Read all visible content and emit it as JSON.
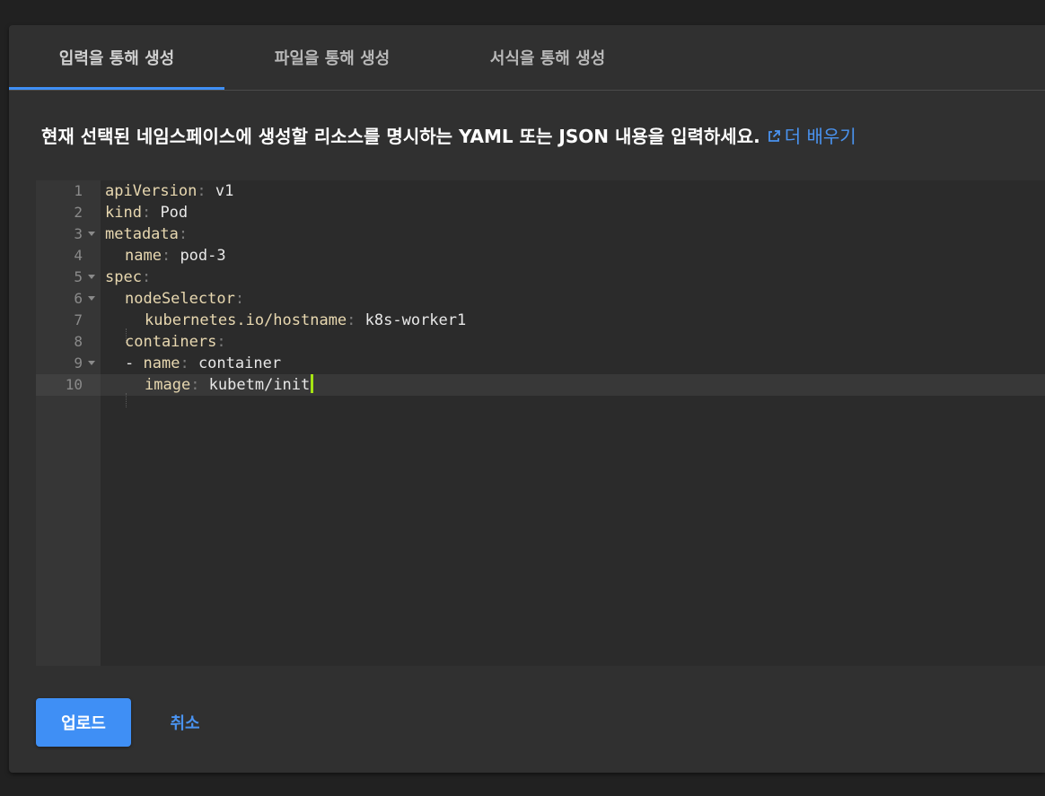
{
  "tabs": [
    {
      "label": "입력을 통해 생성",
      "active": true
    },
    {
      "label": "파일을 통해 생성",
      "active": false
    },
    {
      "label": "서식을 통해 생성",
      "active": false
    }
  ],
  "description": {
    "text": "현재 선택된 네임스페이스에 생성할 리소스를 명시하는 YAML 또는 JSON 내용을 입력하세요.",
    "link_label": "더 배우기",
    "link_icon": "external-link-icon"
  },
  "editor": {
    "language": "YAML",
    "active_line": 10,
    "lines": [
      {
        "num": "1",
        "key": "apiVersion",
        "value": "v1"
      },
      {
        "num": "2",
        "key": "kind",
        "value": "Pod"
      },
      {
        "num": "3",
        "key": "metadata",
        "value": ""
      },
      {
        "num": "4",
        "key": "name",
        "value": "pod-3"
      },
      {
        "num": "5",
        "key": "spec",
        "value": ""
      },
      {
        "num": "6",
        "key": "nodeSelector",
        "value": ""
      },
      {
        "num": "7",
        "key": "kubernetes.io/hostname",
        "value": "k8s-worker1"
      },
      {
        "num": "8",
        "key": "containers",
        "value": ""
      },
      {
        "num": "9",
        "dash": "-",
        "key": "name",
        "value": "container"
      },
      {
        "num": "10",
        "key": "image",
        "value": "kubetm/init"
      }
    ]
  },
  "actions": {
    "upload_label": "업로드",
    "cancel_label": "취소"
  },
  "colors": {
    "accent": "#3f8ff5",
    "cursor": "#a5e412",
    "yaml_key": "#e8d8b0"
  }
}
